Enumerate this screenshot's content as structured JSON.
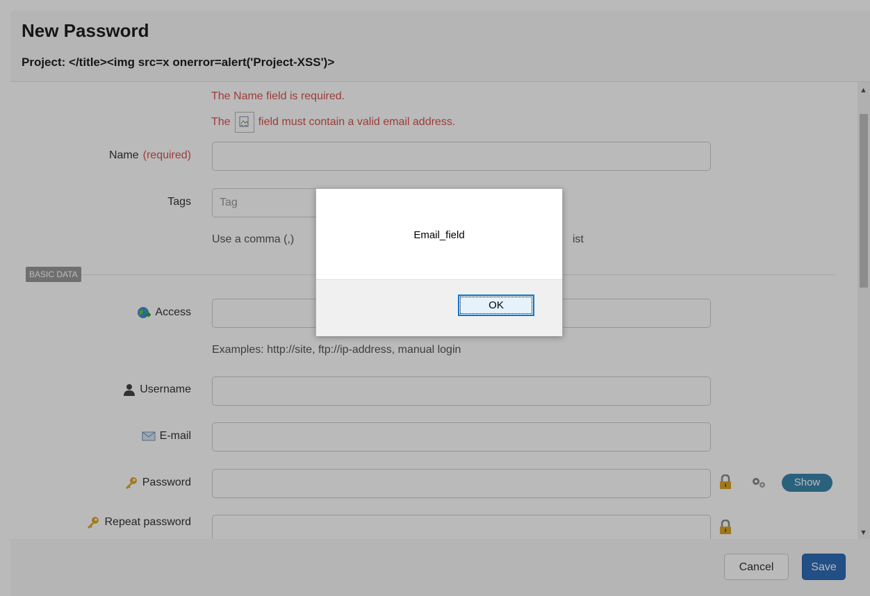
{
  "header": {
    "title": "New Password",
    "project_line": "Project: </title><img src=x onerror=alert('Project-XSS')>"
  },
  "errors": {
    "name_required": "The Name field is required.",
    "email_prefix": "The",
    "email_suffix": "field must contain a valid email address."
  },
  "form": {
    "name_label": "Name",
    "name_required": "(required)",
    "tags_label": "Tags",
    "tags_placeholder": "Tag",
    "tags_help_left": "Use a comma (,)",
    "tags_help_right": "ist",
    "section_label": "BASIC DATA",
    "access_label": "Access",
    "access_help": "Examples: http://site, ftp://ip-address, manual login",
    "username_label": "Username",
    "email_label": "E-mail",
    "password_label": "Password",
    "repeat_password_label": "Repeat password",
    "show_label": "Show"
  },
  "footer": {
    "cancel_label": "Cancel",
    "save_label": "Save"
  },
  "dialog": {
    "message": "Email_field",
    "ok_label": "OK"
  },
  "colors": {
    "error": "#d9534f",
    "primary": "#2f6db8",
    "badge": "#3a87ad"
  }
}
